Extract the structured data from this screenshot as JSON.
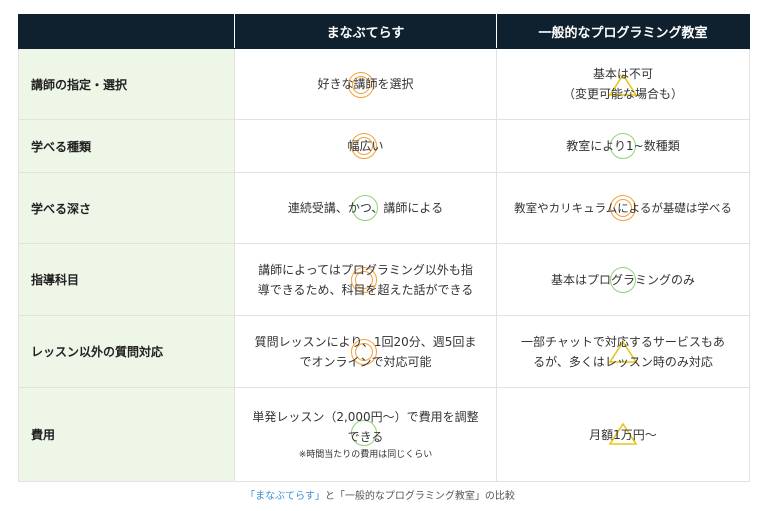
{
  "table": {
    "headers": [
      "まなぶてらす",
      "一般的なプログラミング教室"
    ],
    "rows": [
      {
        "label": "講師の指定・選択",
        "manabu": "好きな講師を選択",
        "general_l1": "基本は不可",
        "general_l2": "（変更可能な場合も）"
      },
      {
        "label": "学べる種類",
        "manabu": "幅広い",
        "general": "教室により1~数種類"
      },
      {
        "label": "学べる深さ",
        "manabu": "連続受講、かつ、講師による",
        "general": "教室やカリキュラムによるが基礎は学べる"
      },
      {
        "label": "指導科目",
        "manabu_l1": "講師によってはプログラミング以外も指",
        "manabu_l2": "導できるため、科目を超えた話ができる",
        "general": "基本はプログラミングのみ"
      },
      {
        "label": "レッスン以外の質問対応",
        "manabu_l1": "質問レッスンにより、1回20分、週5回ま",
        "manabu_l2": "でオンラインで対応可能",
        "general_l1": "一部チャットで対応するサービスもあ",
        "general_l2": "るが、多くはレッスン時のみ対応"
      },
      {
        "label": "費用",
        "manabu_l1": "単発レッスン（2,000円〜）で費用を調整",
        "manabu_l2": "できる",
        "manabu_note": "※時間当たりの費用は同じくらい",
        "general": "月額1万円〜"
      }
    ]
  },
  "marks": {
    "double_circle": "orange double circle",
    "circle": "green circle",
    "triangle": "yellow triangle",
    "colors": {
      "orange": "#f2a23a",
      "green": "#8fd37a",
      "yellow": "#e6c619",
      "header_bg": "#0f202e",
      "label_bg": "#eef6e8"
    }
  },
  "caption": {
    "highlight": "「まなぶてらす」",
    "rest": "と「一般的なプログラミング教室」の比較"
  }
}
